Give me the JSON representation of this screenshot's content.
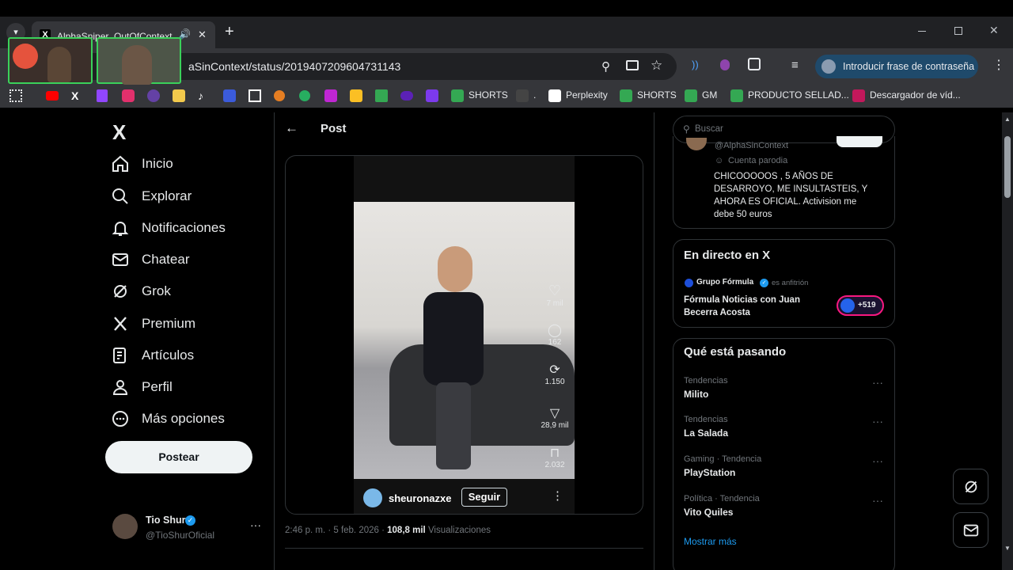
{
  "browser": {
    "tab_title": "AlphaSniper_OutOfContext",
    "new_tab": "+",
    "url": "aSinContext/status/2019407209604731143",
    "profile_label": "Introducir frase de contraseña",
    "bookmarks": [
      {
        "label": "SHORTS"
      },
      {
        "label": "."
      },
      {
        "label": "Perplexity"
      },
      {
        "label": "SHORTS"
      },
      {
        "label": "GM"
      },
      {
        "label": "PRODUCTO SELLAD..."
      },
      {
        "label": "Descargador de víd..."
      }
    ]
  },
  "sidebar": {
    "logo": "X",
    "items": [
      {
        "label": "Inicio"
      },
      {
        "label": "Explorar"
      },
      {
        "label": "Notificaciones"
      },
      {
        "label": "Chatear"
      },
      {
        "label": "Grok"
      },
      {
        "label": "Premium"
      },
      {
        "label": "Artículos"
      },
      {
        "label": "Perfil"
      },
      {
        "label": "Más opciones"
      }
    ],
    "post_button": "Postear",
    "account": {
      "name": "Tio Shur",
      "handle": "@TioShurOficial",
      "more": "···"
    }
  },
  "main": {
    "header": "Post",
    "video": {
      "likes": "7 mil",
      "comments": "162",
      "reposts": "1.150",
      "shares": "28,9 mil",
      "saves": "2.032",
      "username": "sheuronazxe",
      "follow_button": "Seguir"
    },
    "meta": {
      "time": "2:46 p. m. · 5 feb. 2026 ·",
      "views": "108,8 mil",
      "views_label": "Visualizaciones"
    }
  },
  "right": {
    "search_placeholder": "Buscar",
    "quoted": {
      "handle": "@AlphaSinContext",
      "badge": "Cuenta parodia",
      "text": "CHICOOOOOS , 5 AÑOS DE DESARROYO, ME INSULTASTEIS, Y AHORA ES OFICIAL. Activision me debe 50 euros"
    },
    "live": {
      "title": "En directo en X",
      "host": "Grupo Fórmula",
      "host_role": "es anfitrión",
      "show": "Fórmula Noticias con Juan Becerra Acosta",
      "listeners": "+519"
    },
    "trends": {
      "title": "Qué está pasando",
      "items": [
        {
          "category": "Tendencias",
          "name": "Milito"
        },
        {
          "category": "Tendencias",
          "name": "La Salada"
        },
        {
          "category": "Gaming · Tendencia",
          "name": "PlayStation"
        },
        {
          "category": "Política · Tendencia",
          "name": "Vito Quiles"
        }
      ],
      "more": "···",
      "show_more": "Mostrar más"
    }
  },
  "colors": {
    "accent": "#1d9bf0",
    "background": "#000000",
    "border": "#2f3336",
    "muted": "#71767b"
  }
}
